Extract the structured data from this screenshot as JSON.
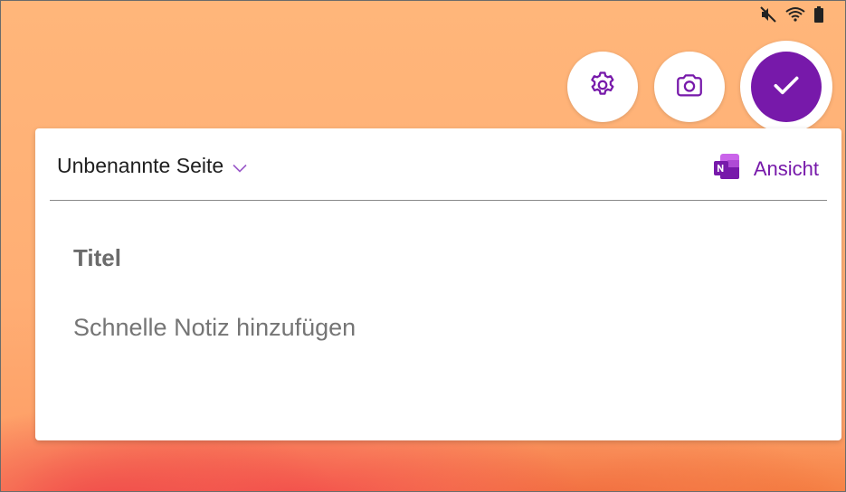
{
  "status_bar": {
    "icons": [
      "mute-icon",
      "wifi-icon",
      "battery-icon"
    ]
  },
  "actions": {
    "settings_icon": "gear-icon",
    "camera_icon": "camera-icon",
    "confirm_icon": "checkmark-icon"
  },
  "header": {
    "page_name": "Unbenannte Seite",
    "dropdown_icon": "chevron-down-icon",
    "app_icon": "onenote-logo-icon",
    "view_label": "Ansicht"
  },
  "editor": {
    "title_placeholder": "Titel",
    "body_placeholder": "Schnelle Notiz hinzufügen"
  },
  "colors": {
    "accent": "#7719aa",
    "background": "#ffb67a"
  }
}
